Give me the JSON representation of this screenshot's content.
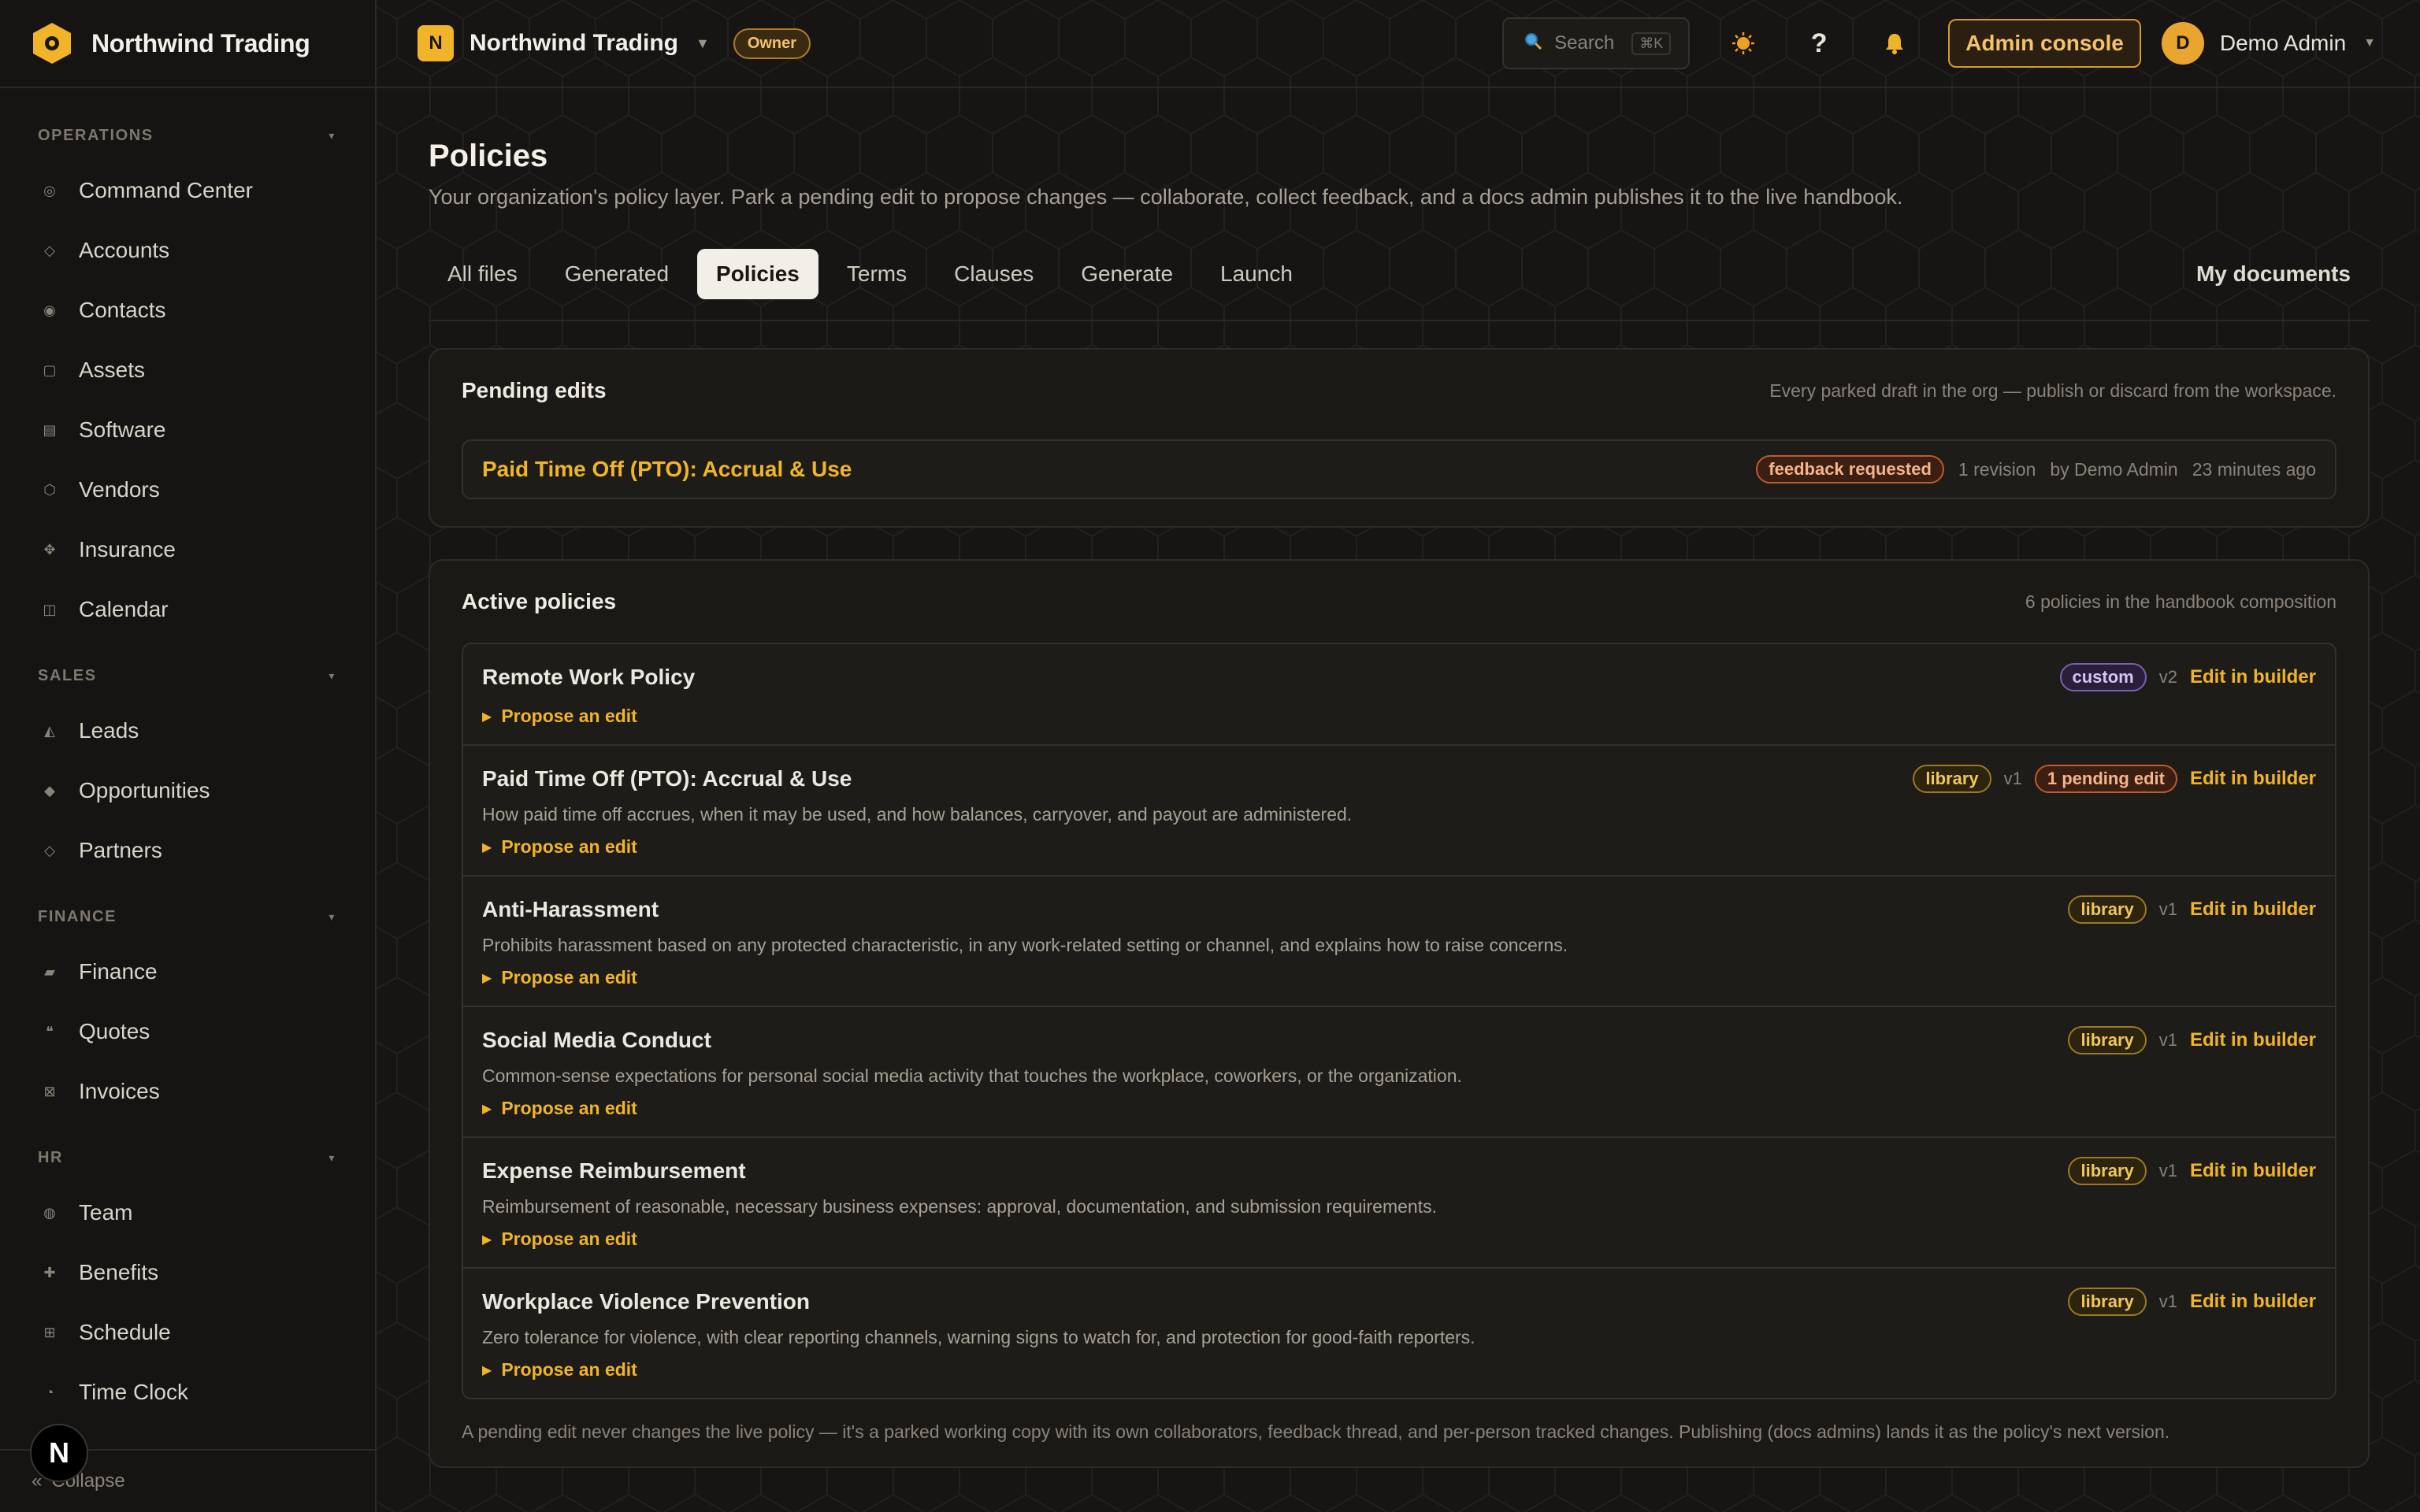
{
  "brand": {
    "name": "Northwind Trading"
  },
  "sidebar": {
    "sections": [
      {
        "label": "OPERATIONS",
        "items": [
          {
            "label": "Command Center",
            "icon": "target-icon"
          },
          {
            "label": "Accounts",
            "icon": "diamond-icon"
          },
          {
            "label": "Contacts",
            "icon": "dot-icon"
          },
          {
            "label": "Assets",
            "icon": "square-icon"
          },
          {
            "label": "Software",
            "icon": "list-icon"
          },
          {
            "label": "Vendors",
            "icon": "hexagon-icon"
          },
          {
            "label": "Insurance",
            "icon": "cross-icon"
          },
          {
            "label": "Calendar",
            "icon": "calendar-icon"
          }
        ]
      },
      {
        "label": "SALES",
        "items": [
          {
            "label": "Leads",
            "icon": "triangle-icon"
          },
          {
            "label": "Opportunities",
            "icon": "diamond-filled-icon"
          },
          {
            "label": "Partners",
            "icon": "diamond-icon"
          }
        ]
      },
      {
        "label": "FINANCE",
        "items": [
          {
            "label": "Finance",
            "icon": "parallelogram-icon"
          },
          {
            "label": "Quotes",
            "icon": "quote-icon"
          },
          {
            "label": "Invoices",
            "icon": "invoice-icon"
          }
        ]
      },
      {
        "label": "HR",
        "items": [
          {
            "label": "Team",
            "icon": "circle-icon"
          },
          {
            "label": "Benefits",
            "icon": "plus-icon"
          },
          {
            "label": "Schedule",
            "icon": "grid-icon"
          },
          {
            "label": "Time Clock",
            "icon": "clock-icon"
          }
        ]
      }
    ],
    "collapse_label": "Collapse",
    "floating_badge": "N"
  },
  "topbar": {
    "org_initial": "N",
    "org_name": "Northwind Trading",
    "role": "Owner",
    "search_placeholder": "Search",
    "search_shortcut": "⌘K",
    "admin_console": "Admin console",
    "user_initial": "D",
    "user_name": "Demo Admin"
  },
  "page": {
    "title": "Policies",
    "subtitle": "Your organization's policy layer. Park a pending edit to propose changes — collaborate, collect feedback, and a docs admin publishes it to the live handbook."
  },
  "tabs": [
    "All files",
    "Generated",
    "Policies",
    "Terms",
    "Clauses",
    "Generate",
    "Launch"
  ],
  "tab_right": "My documents",
  "pending": {
    "title": "Pending edits",
    "note": "Every parked draft in the org — publish or discard from the workspace.",
    "item": {
      "title": "Paid Time Off (PTO): Accrual & Use",
      "status": "feedback requested",
      "revisions": "1 revision",
      "author": "by Demo Admin",
      "time": "23 minutes ago"
    }
  },
  "active": {
    "title": "Active policies",
    "note": "6 policies in the handbook composition",
    "propose_label": "Propose an edit",
    "edit_label": "Edit in builder",
    "policies": [
      {
        "name": "Remote Work Policy",
        "tag": "custom",
        "version": "v2",
        "description": "",
        "pending": ""
      },
      {
        "name": "Paid Time Off (PTO): Accrual & Use",
        "tag": "library",
        "version": "v1",
        "description": "How paid time off accrues, when it may be used, and how balances, carryover, and payout are administered.",
        "pending": "1 pending edit"
      },
      {
        "name": "Anti-Harassment",
        "tag": "library",
        "version": "v1",
        "description": "Prohibits harassment based on any protected characteristic, in any work-related setting or channel, and explains how to raise concerns.",
        "pending": ""
      },
      {
        "name": "Social Media Conduct",
        "tag": "library",
        "version": "v1",
        "description": "Common-sense expectations for personal social media activity that touches the workplace, coworkers, or the organization.",
        "pending": ""
      },
      {
        "name": "Expense Reimbursement",
        "tag": "library",
        "version": "v1",
        "description": "Reimbursement of reasonable, necessary business expenses: approval, documentation, and submission requirements.",
        "pending": ""
      },
      {
        "name": "Workplace Violence Prevention",
        "tag": "library",
        "version": "v1",
        "description": "Zero tolerance for violence, with clear reporting channels, warning signs to watch for, and protection for good-faith reporters.",
        "pending": ""
      }
    ],
    "footnote": "A pending edit never changes the live policy — it's a parked working copy with its own collaborators, feedback thread, and per-person tracked changes. Publishing (docs admins) lands it as the policy's next version."
  },
  "colors": {
    "accent": "#f0b429",
    "background": "#171513",
    "panel": "#1b1916"
  }
}
